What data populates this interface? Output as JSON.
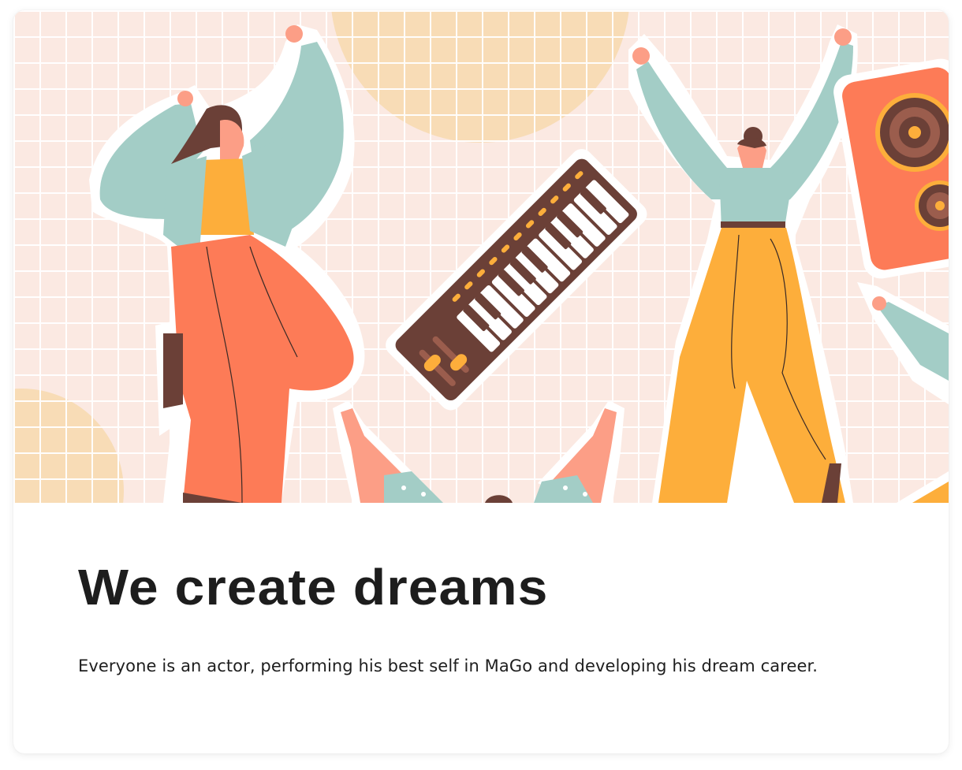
{
  "hero": {
    "illustration": "dancing-people-illustration",
    "icons": [
      "piano-keyboard-icon",
      "speaker-icon"
    ],
    "colors": {
      "background": "#fbe9e2",
      "grid": "#ffffff",
      "sun": "#f8dcb6",
      "teal": "#a3cdc6",
      "orange": "#fd7b57",
      "yellow": "#fdae3b",
      "brown": "#6b4037",
      "skin": "#fc9e86"
    }
  },
  "main": {
    "title": "We create dreams",
    "description": "Everyone is an actor, performing his best self in MaGo and developing his dream career."
  }
}
